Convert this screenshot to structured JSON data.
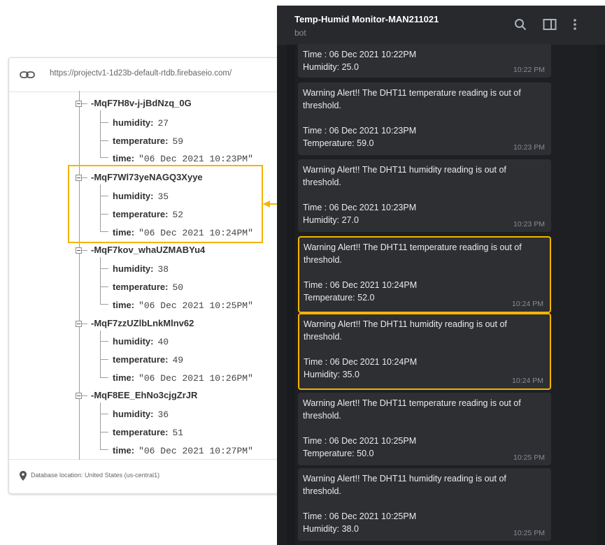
{
  "firebase": {
    "url": "https://projectv1-1d23b-default-rtdb.firebaseio.com/",
    "location": "Database location: United States (us-central1)",
    "nodes": [
      {
        "key": "-MqF7H8v-j-jBdNzq_0G",
        "humidity_label": "humidity:",
        "humidity": "27",
        "temperature_label": "temperature:",
        "temperature": "59",
        "time_label": "time:",
        "time": "\"06 Dec 2021 10:23PM\""
      },
      {
        "key": "-MqF7Wl73yeNAGQ3Xyye",
        "humidity_label": "humidity:",
        "humidity": "35",
        "temperature_label": "temperature:",
        "temperature": "52",
        "time_label": "time:",
        "time": "\"06 Dec 2021 10:24PM\""
      },
      {
        "key": "-MqF7kov_whaUZMABYu4",
        "humidity_label": "humidity:",
        "humidity": "38",
        "temperature_label": "temperature:",
        "temperature": "50",
        "time_label": "time:",
        "time": "\"06 Dec 2021 10:25PM\""
      },
      {
        "key": "-MqF7zzUZlbLnkMlnv62",
        "humidity_label": "humidity:",
        "humidity": "40",
        "temperature_label": "temperature:",
        "temperature": "49",
        "time_label": "time:",
        "time": "\"06 Dec 2021 10:26PM\""
      },
      {
        "key": "-MqF8EE_EhNo3cjgZrJR",
        "humidity_label": "humidity:",
        "humidity": "36",
        "temperature_label": "temperature:",
        "temperature": "51",
        "time_label": "time:",
        "time": "\"06 Dec 2021 10:27PM\""
      }
    ]
  },
  "telegram": {
    "title": "Temp-Humid Monitor-MAN211021",
    "subtitle": "bot",
    "messages": [
      {
        "line1": "Time : 06 Dec 2021 10:22PM",
        "line2": "Humidity: 25.0",
        "time": "10:22 PM"
      },
      {
        "alert": "Warning Alert!! The DHT11 temperature reading is out of threshold.",
        "line1": "Time : 06 Dec 2021 10:23PM",
        "line2": "Temperature: 59.0",
        "time": "10:23 PM"
      },
      {
        "alert": "Warning Alert!! The DHT11 humidity reading is out of threshold.",
        "line1": "Time : 06 Dec 2021 10:23PM",
        "line2": "Humidity: 27.0",
        "time": "10:23 PM"
      },
      {
        "alert": "Warning Alert!! The DHT11 temperature reading is out of threshold.",
        "line1": "Time : 06 Dec 2021 10:24PM",
        "line2": "Temperature: 52.0",
        "time": "10:24 PM"
      },
      {
        "alert": "Warning Alert!! The DHT11 humidity reading is out of threshold.",
        "line1": "Time : 06 Dec 2021 10:24PM",
        "line2": "Humidity: 35.0",
        "time": "10:24 PM"
      },
      {
        "alert": "Warning Alert!! The DHT11 temperature reading is out of threshold.",
        "line1": "Time : 06 Dec 2021 10:25PM",
        "line2": "Temperature: 50.0",
        "time": "10:25 PM"
      },
      {
        "alert": "Warning Alert!! The DHT11 humidity reading is out of threshold.",
        "line1": "Time : 06 Dec 2021 10:25PM",
        "line2": "Humidity: 38.0",
        "time": "10:25 PM"
      }
    ]
  },
  "icons": {
    "link": "link-icon",
    "pin": "location-pin-icon",
    "search": "search-icon",
    "panel": "sidebar-panel-icon",
    "more": "more-vertical-icon"
  },
  "colors": {
    "highlight": "#f4b400",
    "telegram_bg": "#1e1f22",
    "bubble": "#2d2f33",
    "firebase_blue": "#1a73e8"
  }
}
